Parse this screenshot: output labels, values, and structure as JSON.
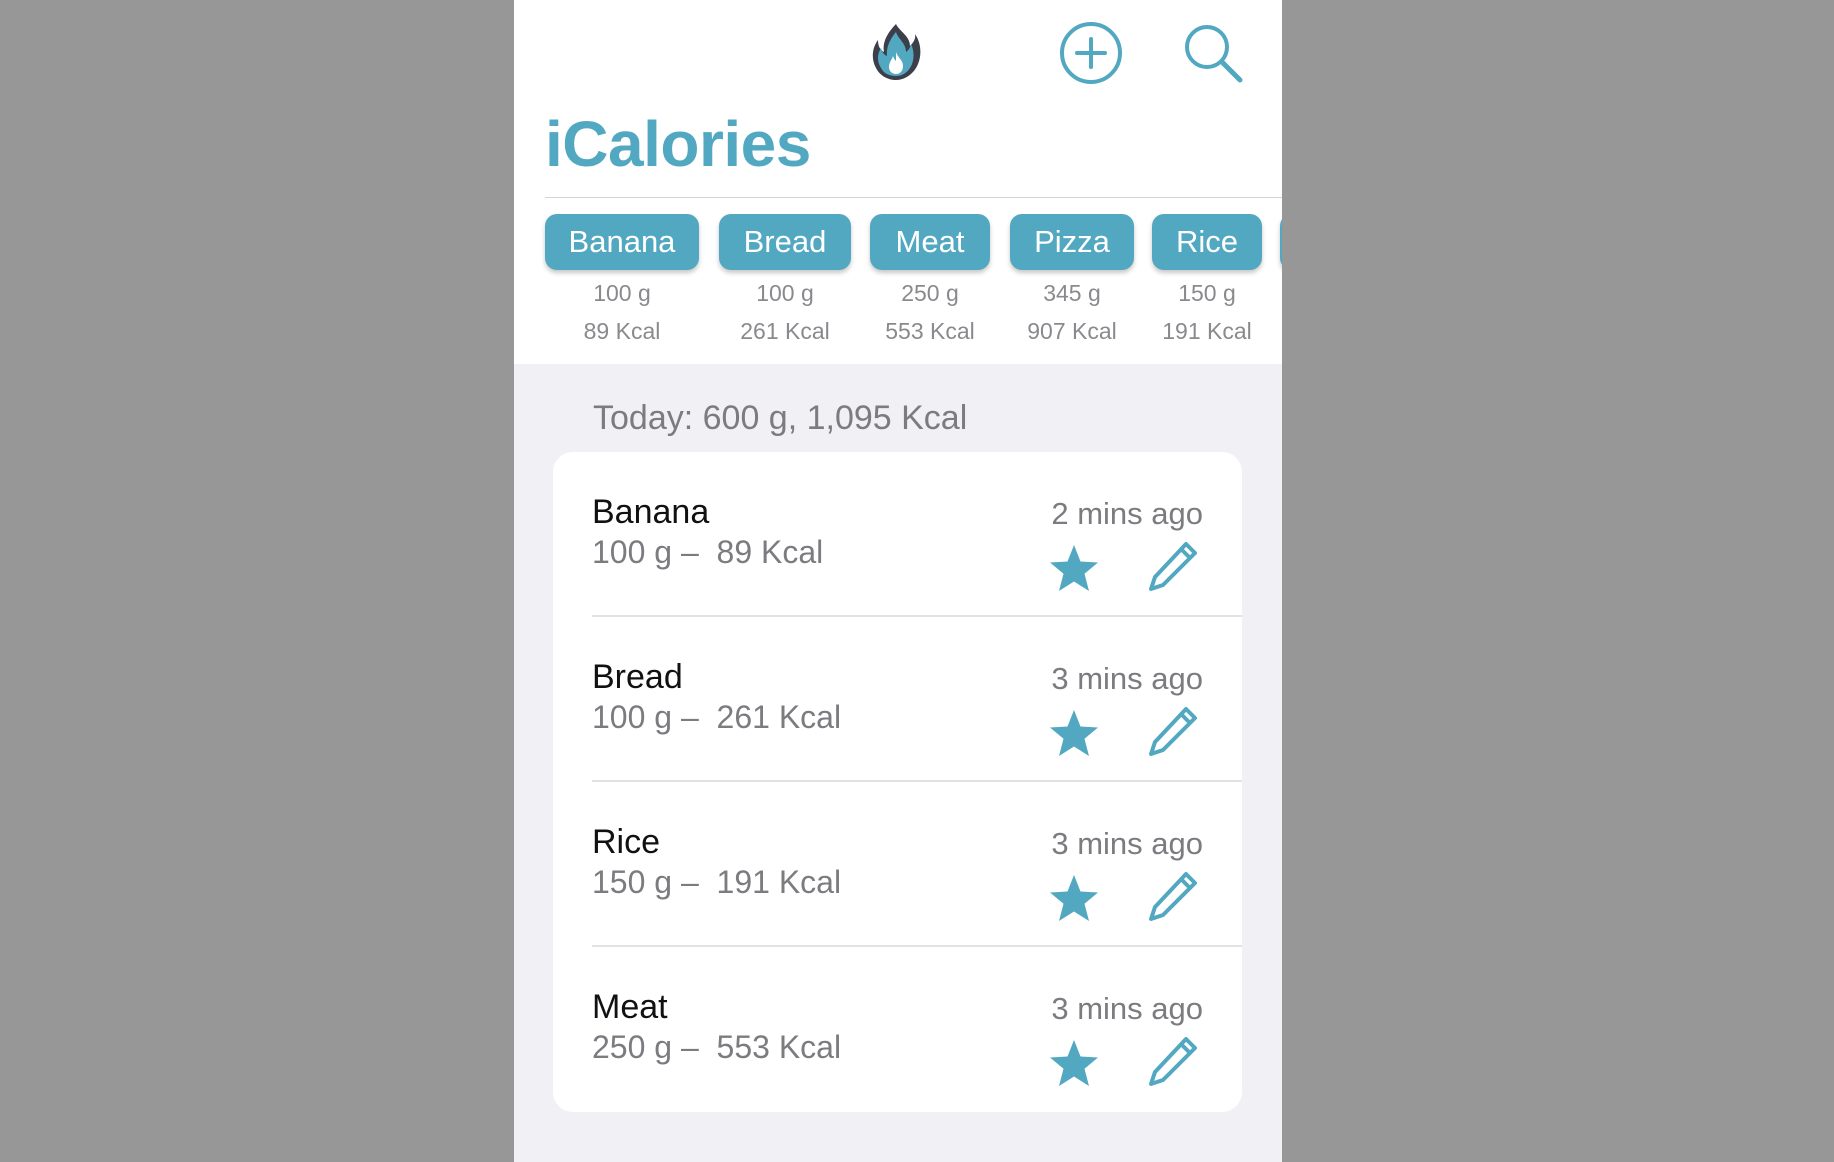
{
  "app": {
    "title": "iCalories",
    "accent_color": "#52a8c1",
    "logo_icon": "flame-icon",
    "add_icon": "plus-circle-icon",
    "search_icon": "search-icon"
  },
  "quick_add": [
    {
      "name": "Banana",
      "weight": "100 g",
      "kcal": "89 Kcal"
    },
    {
      "name": "Bread",
      "weight": "100 g",
      "kcal": "261 Kcal"
    },
    {
      "name": "Meat",
      "weight": "250 g",
      "kcal": "553 Kcal"
    },
    {
      "name": "Pizza",
      "weight": "345 g",
      "kcal": "907 Kcal"
    },
    {
      "name": "Rice",
      "weight": "150 g",
      "kcal": "191 Kcal"
    }
  ],
  "today": {
    "summary": "Today: 600 g, 1,095 Kcal"
  },
  "entries": [
    {
      "name": "Banana",
      "detail": "100 g –  89 Kcal",
      "time": "2 mins ago"
    },
    {
      "name": "Bread",
      "detail": "100 g –  261 Kcal",
      "time": "3 mins ago"
    },
    {
      "name": "Rice",
      "detail": "150 g –  191 Kcal",
      "time": "3 mins ago"
    },
    {
      "name": "Meat",
      "detail": "250 g –  553 Kcal",
      "time": "3 mins ago"
    }
  ]
}
